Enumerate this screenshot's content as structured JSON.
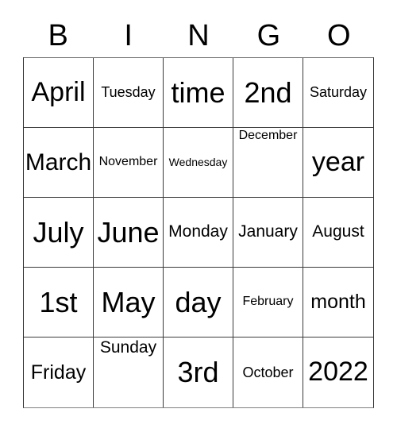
{
  "card": {
    "title": "BINGO card",
    "header_letters": [
      "B",
      "I",
      "N",
      "G",
      "O"
    ],
    "columns": 5,
    "rows": 5,
    "border_color": "#333333",
    "text_color": "#000000",
    "background_color": "#ffffff",
    "cells": [
      [
        {
          "text": "April",
          "size": "xl",
          "align": "middle"
        },
        {
          "text": "Tuesday",
          "size": "xs",
          "align": "middle"
        },
        {
          "text": "time",
          "size": "xxl",
          "align": "middle"
        },
        {
          "text": "2nd",
          "size": "xxl",
          "align": "middle"
        },
        {
          "text": "Saturday",
          "size": "xs",
          "align": "middle"
        }
      ],
      [
        {
          "text": "March",
          "size": "lg",
          "align": "middle"
        },
        {
          "text": "November",
          "size": "xxs",
          "align": "middle"
        },
        {
          "text": "Wednesday",
          "size": "tiny",
          "align": "middle"
        },
        {
          "text": "December",
          "size": "xxs",
          "align": "top"
        },
        {
          "text": "year",
          "size": "xl",
          "align": "middle"
        }
      ],
      [
        {
          "text": "July",
          "size": "xxl",
          "align": "middle"
        },
        {
          "text": "June",
          "size": "xxl",
          "align": "middle"
        },
        {
          "text": "Monday",
          "size": "sm",
          "align": "middle"
        },
        {
          "text": "January",
          "size": "sm",
          "align": "middle"
        },
        {
          "text": "August",
          "size": "sm",
          "align": "middle"
        }
      ],
      [
        {
          "text": "1st",
          "size": "xxl",
          "align": "middle"
        },
        {
          "text": "May",
          "size": "xxl",
          "align": "middle"
        },
        {
          "text": "day",
          "size": "xxl",
          "align": "middle"
        },
        {
          "text": "February",
          "size": "xxs",
          "align": "middle"
        },
        {
          "text": "month",
          "size": "md",
          "align": "middle"
        }
      ],
      [
        {
          "text": "Friday",
          "size": "md",
          "align": "middle"
        },
        {
          "text": "Sunday",
          "size": "sm",
          "align": "top"
        },
        {
          "text": "3rd",
          "size": "xxl",
          "align": "middle"
        },
        {
          "text": "October",
          "size": "xs",
          "align": "middle"
        },
        {
          "text": "2022",
          "size": "xl",
          "align": "middle"
        }
      ]
    ]
  }
}
